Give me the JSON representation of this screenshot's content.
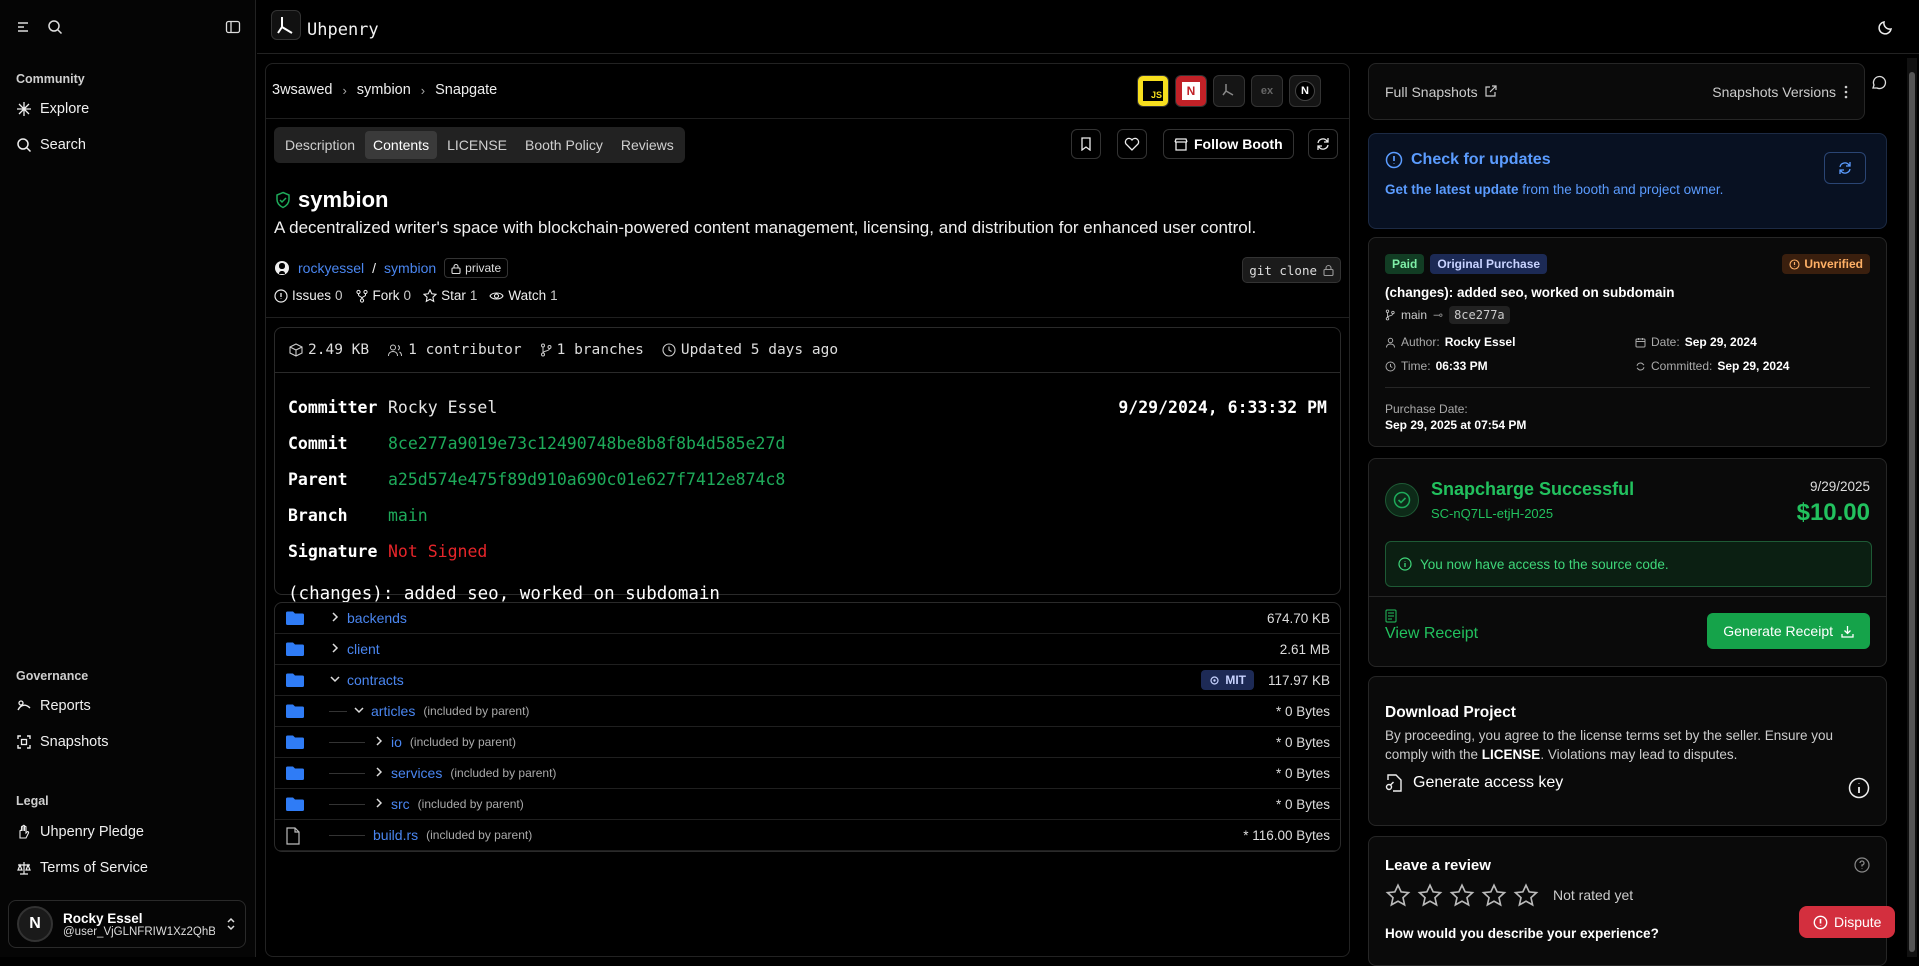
{
  "app": {
    "title": "Uhpenry"
  },
  "sidebar": {
    "community_label": "Community",
    "community_items": [
      {
        "label": "Explore"
      },
      {
        "label": "Search"
      }
    ],
    "governance_label": "Governance",
    "governance_items": [
      {
        "label": "Reports"
      },
      {
        "label": "Snapshots"
      }
    ],
    "legal_label": "Legal",
    "legal_items": [
      {
        "label": "Uhpenry Pledge"
      },
      {
        "label": "Terms of Service"
      }
    ],
    "user": {
      "initial": "N",
      "name": "Rocky Essel",
      "handle": "@user_VjGLNFRIW1Xz2QhB..."
    }
  },
  "breadcrumb": [
    "3wsawed",
    "symbion",
    "Snapgate"
  ],
  "tech_badges": [
    "JS",
    "N",
    "",
    "ex",
    "N"
  ],
  "tabs": [
    "Description",
    "Contents",
    "LICENSE",
    "Booth Policy",
    "Reviews"
  ],
  "active_tab": "Contents",
  "follow_label": "Follow Booth",
  "repo": {
    "name": "symbion",
    "description": "A decentralized writer's space with blockchain-powered content management, licensing, and distribution for enhanced user control.",
    "owner": "rockyessel",
    "repo": "symbion",
    "visibility": "private",
    "git_clone": "git clone",
    "stats": {
      "issues_label": "Issues",
      "issues": "0",
      "fork_label": "Fork",
      "forks": "0",
      "star_label": "Star",
      "stars": "1",
      "watch_label": "Watch",
      "watch": "1"
    }
  },
  "commit": {
    "size": "2.49 KB",
    "contributors": "1 contributor",
    "branches": "1 branches",
    "updated": "Updated 5 days ago",
    "committer_label": "Committer",
    "committer": "Rocky Essel",
    "datetime": "9/29/2024, 6:33:32 PM",
    "commit_label": "Commit",
    "commit_hash": "8ce277a9019e73c12490748be8b8f8b4d585e27d",
    "parent_label": "Parent",
    "parent_hash": "a25d574e475f89d910a690c01e627f7412e874c8",
    "branch_label": "Branch",
    "branch": "main",
    "signature_label": "Signature",
    "signature": "Not Signed",
    "message": "(changes): added seo, worked on subdomain"
  },
  "files": [
    {
      "name": "backends",
      "note": "",
      "size": "674.70 KB",
      "type": "folder",
      "depth": 0,
      "expanded": false
    },
    {
      "name": "client",
      "note": "",
      "size": "2.61 MB",
      "type": "folder",
      "depth": 0,
      "expanded": false
    },
    {
      "name": "contracts",
      "note": "",
      "size": "117.97 KB",
      "type": "folder",
      "depth": 0,
      "expanded": true,
      "license": "MIT"
    },
    {
      "name": "articles",
      "note": "(included by parent)",
      "size": "* 0 Bytes",
      "type": "folder",
      "depth": 1,
      "expanded": true
    },
    {
      "name": "io",
      "note": "(included by parent)",
      "size": "* 0 Bytes",
      "type": "folder",
      "depth": 2,
      "expanded": false
    },
    {
      "name": "services",
      "note": "(included by parent)",
      "size": "* 0 Bytes",
      "type": "folder",
      "depth": 2,
      "expanded": false
    },
    {
      "name": "src",
      "note": "(included by parent)",
      "size": "* 0 Bytes",
      "type": "folder",
      "depth": 2,
      "expanded": false
    },
    {
      "name": "build.rs",
      "note": "(included by parent)",
      "size": "* 116.00 Bytes",
      "type": "file",
      "depth": 2,
      "expanded": false
    }
  ],
  "snapshots": {
    "full_label": "Full Snapshots",
    "versions_label": "Snapshots Versions"
  },
  "update": {
    "title": "Check for updates",
    "link": "Get the latest update",
    "rest": " from the booth and project owner."
  },
  "purchase": {
    "paid": "Paid",
    "original": "Original Purchase",
    "status": "Unverified",
    "message": "(changes): added seo, worked on subdomain",
    "branch": "main",
    "hash": "8ce277a",
    "author_label": "Author:",
    "author": "Rocky Essel",
    "date_label": "Date:",
    "date": "Sep 29, 2024",
    "time_label": "Time:",
    "time": "06:33 PM",
    "committed_label": "Committed:",
    "committed": "Sep 29, 2024",
    "purchase_date_label": "Purchase Date:",
    "purchase_date": "Sep 29, 2025 at 07:54 PM"
  },
  "charge": {
    "title": "Snapcharge Successful",
    "id": "SC-nQ7LL-etjH-2025",
    "date": "9/29/2025",
    "amount": "$10.00",
    "notice": "You now have access to the source code.",
    "view_receipt": "View Receipt",
    "generate_receipt": "Generate Receipt"
  },
  "download": {
    "title": "Download Project",
    "text1": "By proceeding, you agree to the license terms set by the seller. Ensure you comply with the ",
    "license": "LICENSE",
    "text2": ". Violations may lead to disputes.",
    "access_key": "Generate access key"
  },
  "review": {
    "title": "Leave a review",
    "rating": 0,
    "not_rated": "Not rated yet",
    "question": "How would you describe your experience?"
  },
  "dispute": "Dispute",
  "colors": {
    "accent_blue": "#4a86f0",
    "success_green": "#1eaa5a",
    "danger_red": "#d32f3e"
  }
}
